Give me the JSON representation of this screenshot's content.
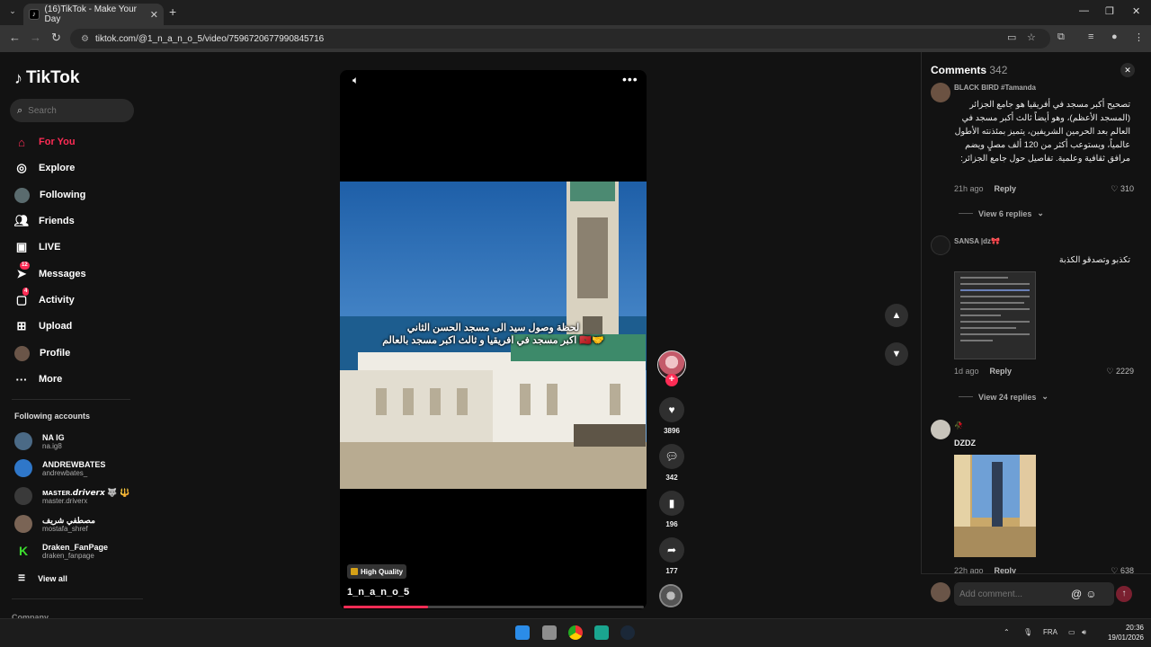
{
  "browser": {
    "tab_title": "(16)TikTok - Make Your Day",
    "url": "tiktok.com/@1_n_a_n_o_5/video/7596720677990845716"
  },
  "sidebar": {
    "logo": "TikTok",
    "search_placeholder": "Search",
    "nav": [
      {
        "label": "For You",
        "icon": "home-icon",
        "active": true
      },
      {
        "label": "Explore",
        "icon": "compass-icon"
      },
      {
        "label": "Following",
        "icon": "following-avatar-icon"
      },
      {
        "label": "Friends",
        "icon": "friends-icon"
      },
      {
        "label": "LIVE",
        "icon": "live-icon"
      },
      {
        "label": "Messages",
        "icon": "messages-icon",
        "badge": "12"
      },
      {
        "label": "Activity",
        "icon": "activity-icon",
        "badge": "4"
      },
      {
        "label": "Upload",
        "icon": "upload-icon"
      },
      {
        "label": "Profile",
        "icon": "profile-avatar-icon"
      },
      {
        "label": "More",
        "icon": "more-dots-icon"
      }
    ],
    "following_title": "Following accounts",
    "accounts": [
      {
        "name": "NA IG",
        "handle": "na.ig8"
      },
      {
        "name": "ANDREWBATES",
        "handle": "andrewbates_"
      },
      {
        "name": "ᴍᴀsᴛᴇʀ.𝙙𝙧𝙞𝙫𝙚𝙧𝙭 🐺 🔱",
        "handle": "master.driverx"
      },
      {
        "name": "مصطفي شريف",
        "handle": "mostafa_shref"
      },
      {
        "name": "Draken_FanPage",
        "handle": "draken_fanpage"
      }
    ],
    "view_all": "View all",
    "company": "Company"
  },
  "video": {
    "caption_line1": "لحظة وصول سيد الى مسجد الحسن الثاني",
    "caption_line2": "اكبر مسجد في افريقيا و ثالث اكبر مسجد بالعالم 🇲🇦🤝",
    "badge": "High Quality",
    "author": "1_n_a_n_o_5",
    "progress": 0.28,
    "likes": "3896",
    "comments": "342",
    "saves": "196",
    "shares": "177"
  },
  "comments": {
    "title": "Comments",
    "count": "342",
    "items": [
      {
        "user": "BLACK BIRD #Tamanda",
        "text": "تصحيح أكبر مسجد في أفريقيا هو جامع الجزائر (المسجد الأعظم)، وهو أيضاً ثالث أكبر مسجد في العالم بعد الحرمين الشريفين، يتميز بمئذنته الأطول عالمياً، ويستوعب أكثر من 120 ألف مصلٍ ويضم مرافق ثقافية وعلمية. تفاصيل حول جامع الجزائر:",
        "time": "21h ago",
        "reply": "Reply",
        "likes": "310",
        "view_replies": "View 6 replies"
      },
      {
        "user": "SANSA |dz🎀",
        "text": "تكذبو وتصدقو الكذبة",
        "time": "1d ago",
        "reply": "Reply",
        "likes": "2229",
        "view_replies": "View 24 replies"
      },
      {
        "user": "🥀",
        "text": "DZDZ",
        "time": "22h ago",
        "reply": "Reply",
        "likes": "638"
      }
    ],
    "add_placeholder": "Add comment..."
  },
  "taskbar": {
    "lang": "FRA",
    "time": "20:36",
    "date": "19/01/2026"
  }
}
